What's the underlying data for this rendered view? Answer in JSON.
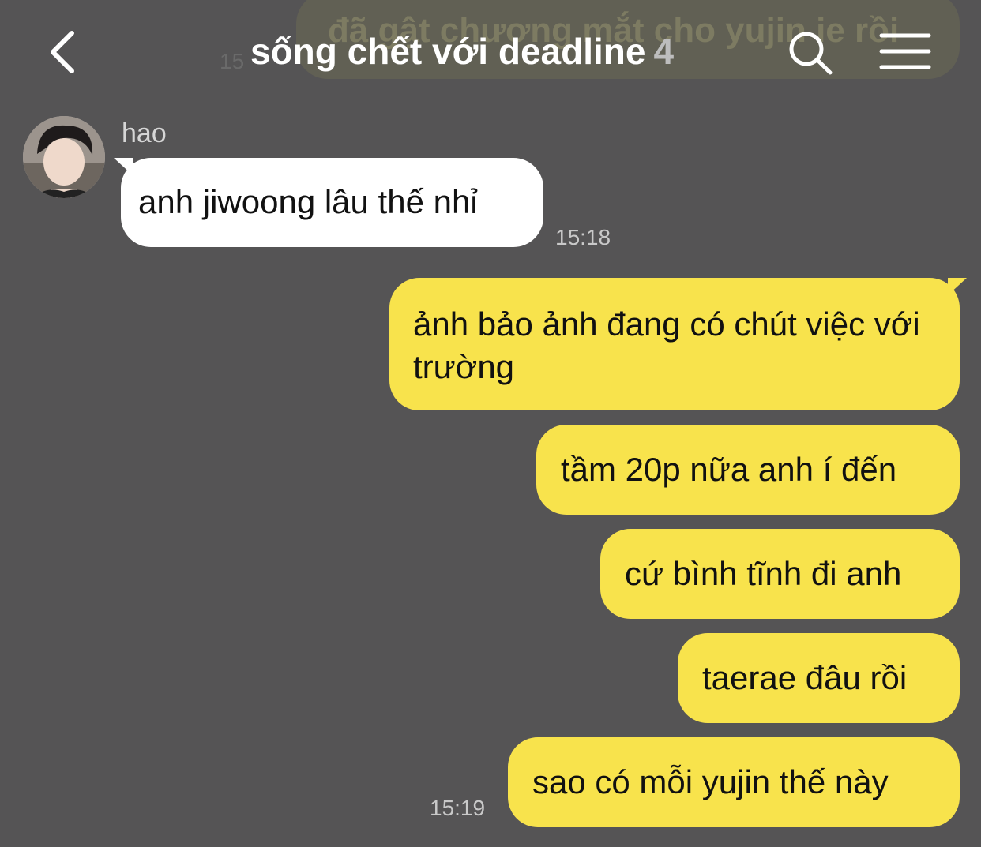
{
  "header": {
    "title": "sống chết với deadline",
    "member_count": "4",
    "back_icon": "chevron-left-icon",
    "search_icon": "search-icon",
    "menu_icon": "hamburger-menu-icon"
  },
  "background_preview": {
    "text": "đã gật chương mắt cho yujin ie rồi",
    "time": "15"
  },
  "messages": [
    {
      "sender": "hao",
      "text": "anh jiwoong lâu thế nhỉ",
      "time": "15:18",
      "incoming": true
    },
    {
      "text": "ảnh bảo ảnh đang có chút việc với trường",
      "incoming": false
    },
    {
      "text": "tầm 20p nữa anh í đến",
      "incoming": false
    },
    {
      "text": "cứ bình tĩnh đi anh",
      "incoming": false
    },
    {
      "text": "taerae đâu rồi",
      "incoming": false
    },
    {
      "text": "sao có mỗi yujin thế này",
      "time": "15:19",
      "incoming": false
    }
  ],
  "colors": {
    "background": "#555455",
    "outgoing_bubble": "#f8e34c",
    "incoming_bubble": "#ffffff"
  }
}
